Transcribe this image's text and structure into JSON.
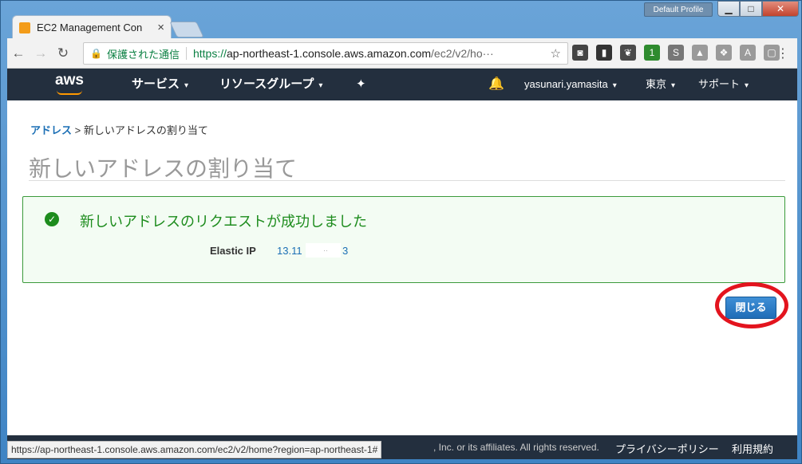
{
  "window": {
    "profile_label": "Default Profile",
    "min_glyph": "▁",
    "max_glyph": "□",
    "close_glyph": "✕"
  },
  "tab": {
    "title": "EC2 Management Con",
    "close_glyph": "×"
  },
  "toolbar": {
    "back_glyph": "←",
    "forward_glyph": "→",
    "reload_glyph": "↻",
    "lock_glyph": "🔒",
    "secure_label": "保護された通信",
    "url_scheme": "https://",
    "url_host": "ap-northeast-1.console.aws.amazon.com",
    "url_path": "/ec2/v2/ho···",
    "star_glyph": "☆",
    "menu_glyph": "⋮"
  },
  "extensions": [
    {
      "name": "pocket-icon",
      "glyph": "◙",
      "color": "#444444"
    },
    {
      "name": "evernote-clipper-icon",
      "glyph": "▮",
      "color": "#333333"
    },
    {
      "name": "evernote-icon",
      "glyph": "❦",
      "color": "#4a4a4a"
    },
    {
      "name": "badge-extension-icon",
      "glyph": "1",
      "color": "#2e8b2e"
    },
    {
      "name": "scribd-icon",
      "glyph": "S",
      "color": "#777777"
    },
    {
      "name": "drive-icon",
      "glyph": "▲",
      "color": "#9a9a9a"
    },
    {
      "name": "dropbox-icon",
      "glyph": "❖",
      "color": "#9a9a9a"
    },
    {
      "name": "acrobat-icon",
      "glyph": "A",
      "color": "#9a9a9a"
    },
    {
      "name": "extension-blank-icon",
      "glyph": "▢",
      "color": "#9a9a9a"
    }
  ],
  "awsnav": {
    "logo_text": "aws",
    "services": "サービス",
    "resource_groups": "リソースグループ",
    "pin_glyph": "✦",
    "bell_glyph": "🔔",
    "user": "yasunari.yamasita",
    "region": "東京",
    "support": "サポート",
    "caret": "▾"
  },
  "breadcrumb": {
    "parent": "アドレス",
    "separator": " > ",
    "current": "新しいアドレスの割り当て"
  },
  "page_title": "新しいアドレスの割り当て",
  "success": {
    "check_glyph": "✓",
    "message": "新しいアドレスのリクエストが成功しました",
    "eip_label": "Elastic IP",
    "eip_value_prefix": "13.11",
    "eip_value_mid": "··",
    "eip_value_suffix": "3"
  },
  "close_button": "閉じる",
  "footer": {
    "copyright": ", Inc. or its affiliates. All rights reserved.",
    "privacy": "プライバシーポリシー",
    "terms": "利用規約"
  },
  "status_url": "https://ap-northeast-1.console.aws.amazon.com/ec2/v2/home?region=ap-northeast-1#"
}
